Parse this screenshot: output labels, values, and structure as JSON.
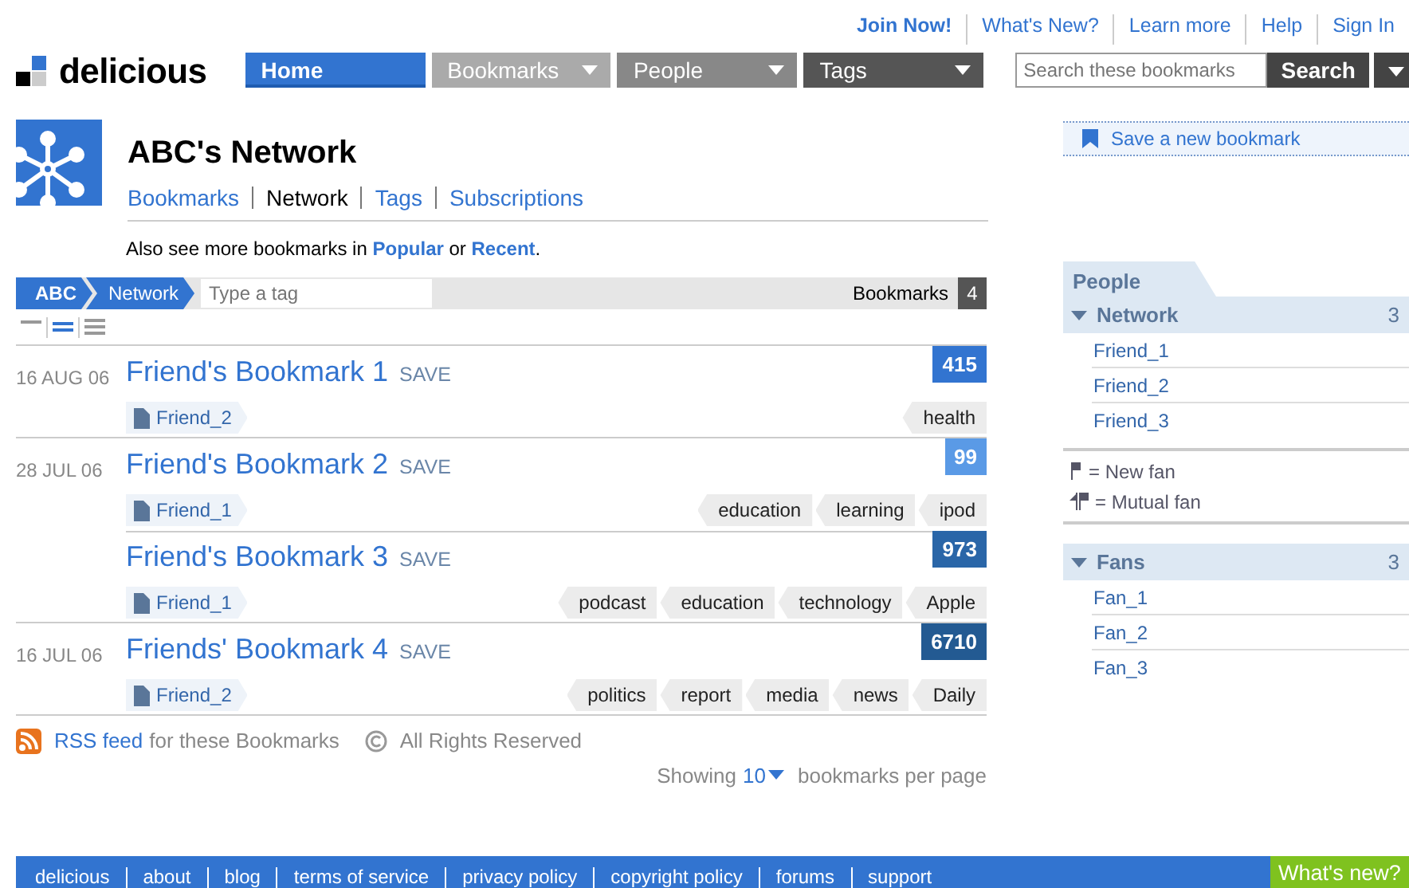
{
  "top_links": [
    {
      "label": "Join Now!",
      "kind": "strong"
    },
    {
      "label": "What's New?",
      "kind": "plain"
    },
    {
      "label": "Learn more",
      "kind": "plain"
    },
    {
      "label": "Help",
      "kind": "plain"
    },
    {
      "label": "Sign In",
      "kind": "plain"
    }
  ],
  "logo": {
    "text": "delicious"
  },
  "nav_tabs": [
    {
      "label": "Home",
      "selected": true,
      "dropdown": false,
      "color": "#3274d0"
    },
    {
      "label": "Bookmarks",
      "selected": false,
      "dropdown": true,
      "color": "#aaaaaa"
    },
    {
      "label": "People",
      "selected": false,
      "dropdown": true,
      "color": "#888888"
    },
    {
      "label": "Tags",
      "selected": false,
      "dropdown": true,
      "color": "#555555"
    }
  ],
  "search": {
    "placeholder": "Search these bookmarks",
    "button": "Search"
  },
  "profile": {
    "title": "ABC's Network",
    "tabs": [
      {
        "label": "Bookmarks",
        "selected": false
      },
      {
        "label": "Network",
        "selected": true
      },
      {
        "label": "Tags",
        "selected": false
      },
      {
        "label": "Subscriptions",
        "selected": false
      }
    ]
  },
  "see_also": {
    "prefix": "Also see more bookmarks in",
    "first": "Popular",
    "joiner": "or",
    "second": "Recent",
    "suffix": "."
  },
  "breadcrumb": {
    "items": [
      "ABC",
      "Network"
    ],
    "tag_placeholder": "Type a tag",
    "count_label": "Bookmarks",
    "count": "4"
  },
  "view_modes": [
    {
      "selected": false
    },
    {
      "selected": true
    },
    {
      "selected": false
    }
  ],
  "bookmarks": [
    {
      "date": "16 AUG 06",
      "title": "Friend's Bookmark 1",
      "save": "SAVE",
      "user": "Friend_2",
      "tags": [
        "health"
      ],
      "count": "415",
      "color": "#3274d0"
    },
    {
      "date": "28 JUL 06",
      "title": "Friend's Bookmark 2",
      "save": "SAVE",
      "user": "Friend_1",
      "tags": [
        "education",
        "learning",
        "ipod"
      ],
      "count": "99",
      "color": "#5a9ae6"
    },
    {
      "title": "Friend's Bookmark 3",
      "save": "SAVE",
      "user": "Friend_1",
      "tags": [
        "podcast",
        "education",
        "technology",
        "Apple"
      ],
      "count": "973",
      "color": "#2a66a8"
    },
    {
      "date": "16 JUL 06",
      "title": "Friends' Bookmark 4",
      "save": "SAVE",
      "user": "Friend_2",
      "tags": [
        "politics",
        "report",
        "media",
        "news",
        "Daily"
      ],
      "count": "6710",
      "color": "#235a92"
    }
  ],
  "rss": {
    "link": "RSS feed",
    "text": "for these Bookmarks",
    "rights": "All Rights Reserved"
  },
  "paging": {
    "prefix": "Showing",
    "value": "10",
    "suffix": "bookmarks per page"
  },
  "sidebar": {
    "save": "Save a new bookmark",
    "tab": "People",
    "groups": [
      {
        "title": "Network",
        "count": "3",
        "expanded": true,
        "items": [
          "Friend_1",
          "Friend_2",
          "Friend_3"
        ],
        "legend": [
          {
            "kind": "new",
            "text": "= New fan"
          },
          {
            "kind": "mutual",
            "text": "= Mutual fan"
          }
        ]
      },
      {
        "title": "Fans",
        "count": "3",
        "expanded": true,
        "items": [
          "Fan_1",
          "Fan_2",
          "Fan_3"
        ]
      }
    ]
  },
  "footer": {
    "links": [
      "delicious",
      "about",
      "blog",
      "terms of service",
      "privacy policy",
      "copyright policy",
      "forums",
      "support"
    ],
    "whats_new": "What's new?"
  }
}
